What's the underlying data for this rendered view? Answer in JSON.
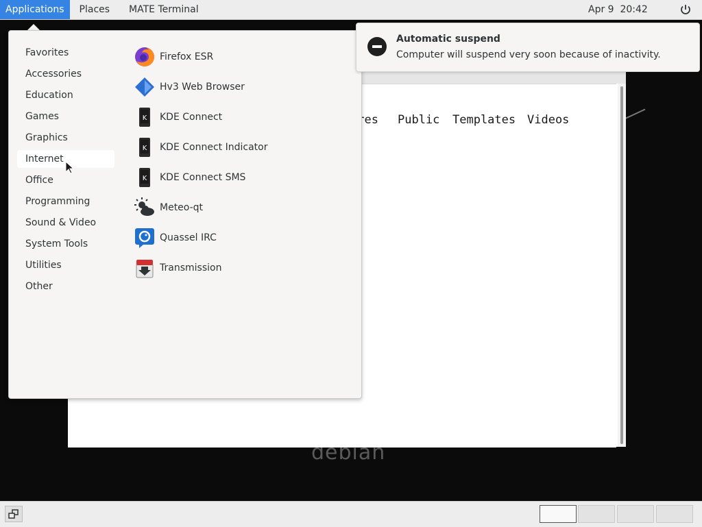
{
  "top_panel": {
    "applications": "Applications",
    "places": "Places",
    "terminal": "MATE Terminal",
    "date": "Apr 9",
    "time": "20:42"
  },
  "apps_menu": {
    "categories": [
      "Favorites",
      "Accessories",
      "Education",
      "Games",
      "Graphics",
      "Internet",
      "Office",
      "Programming",
      "Sound & Video",
      "System Tools",
      "Utilities",
      "Other"
    ],
    "hovered_category": "Internet",
    "apps": [
      {
        "label": "Firefox ESR",
        "icon": "firefox-icon"
      },
      {
        "label": "Hv3 Web Browser",
        "icon": "hv3-icon"
      },
      {
        "label": "KDE Connect",
        "icon": "kde-connect-icon"
      },
      {
        "label": "KDE Connect Indicator",
        "icon": "kde-connect-icon"
      },
      {
        "label": "KDE Connect SMS",
        "icon": "kde-connect-icon"
      },
      {
        "label": "Meteo-qt",
        "icon": "weather-icon"
      },
      {
        "label": "Quassel IRC",
        "icon": "quassel-icon"
      },
      {
        "label": "Transmission",
        "icon": "transmission-icon"
      }
    ]
  },
  "notification": {
    "title": "Automatic suspend",
    "body": "Computer will suspend very soon because of inactivity."
  },
  "background_window": {
    "dirs": [
      "ures",
      "Public",
      "Templates",
      "Videos"
    ]
  },
  "wallpaper": {
    "logo": "debian"
  },
  "colors": {
    "accent": "#3584e4",
    "panel": "#ededed",
    "menu_bg": "#f6f5f4"
  }
}
